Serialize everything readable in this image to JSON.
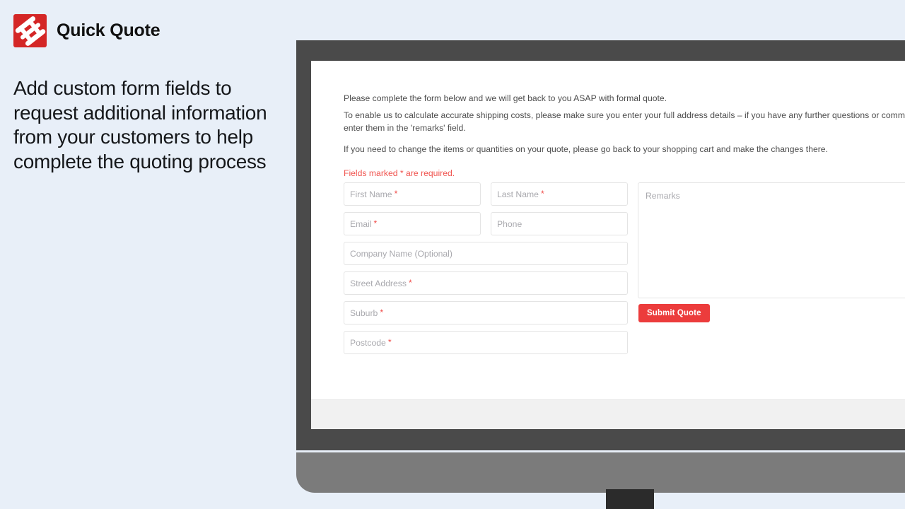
{
  "promo": {
    "brand_title": "Quick Quote",
    "logo_icon": "quick-quote-logo-icon",
    "headline": "Add custom form fields to request additional information from your customers to help complete the quoting process",
    "background_color": "#e8eff8",
    "logo_color": "#d42626"
  },
  "device": {
    "type": "desktop-monitor",
    "frame_color": "#4a4a4a",
    "base_color": "#7b7b7b",
    "stand_color": "#2b2b2b"
  },
  "page": {
    "intro_1": "Please complete the form below and we will get back to you ASAP with formal quote.",
    "intro_2": "To enable us to calculate accurate shipping costs, please make sure you enter your full address details – if you have any further questions or comments, please enter them in the 'remarks' field.",
    "intro_3": "If you need to change the items or quantities on your quote, please go back to your shopping cart and make the changes there.",
    "required_note": "Fields marked * are required.",
    "required_note_color": "#f0544f"
  },
  "form": {
    "required_marker": "*",
    "fields": [
      {
        "name": "first-name",
        "placeholder": "First Name",
        "required": true
      },
      {
        "name": "last-name",
        "placeholder": "Last Name",
        "required": true
      },
      {
        "name": "email",
        "placeholder": "Email",
        "required": true
      },
      {
        "name": "phone",
        "placeholder": "Phone",
        "required": false
      },
      {
        "name": "company-name",
        "placeholder": "Company Name (Optional)",
        "required": false
      },
      {
        "name": "street-address",
        "placeholder": "Street Address",
        "required": true
      },
      {
        "name": "suburb",
        "placeholder": "Suburb",
        "required": true
      },
      {
        "name": "postcode",
        "placeholder": "Postcode",
        "required": true
      }
    ],
    "remarks": {
      "placeholder": "Remarks",
      "value": ""
    },
    "submit_label": "Submit Quote",
    "submit_color": "#ec3c3c"
  }
}
